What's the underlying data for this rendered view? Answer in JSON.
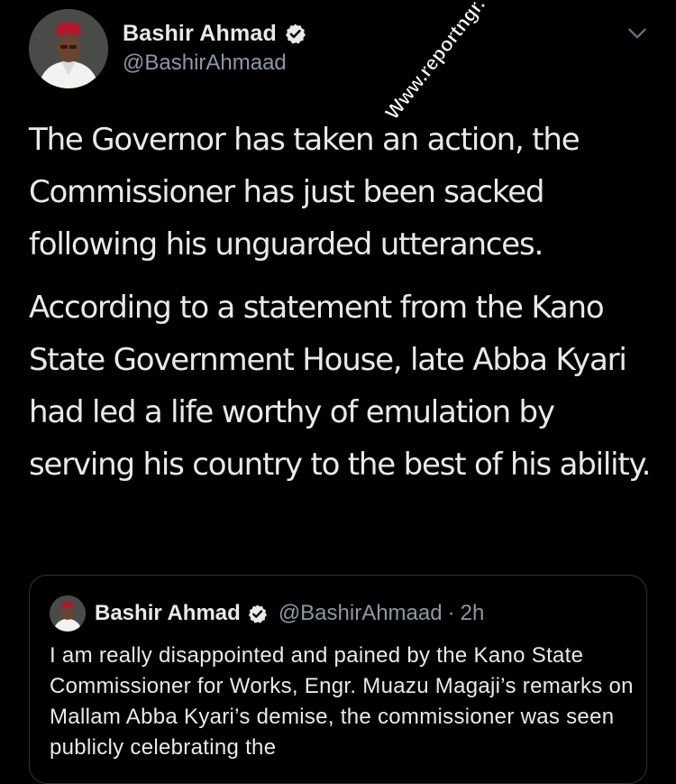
{
  "tweet": {
    "author_name": "Bashir Ahmad",
    "handle": "@BashirAhmaad",
    "paragraphs": [
      "The Governor has taken an action, the Commissioner has just been sacked following his unguarded utterances.",
      "According to a statement from the Kano State Government House, late Abba Kyari had led a life worthy of emulation by serving his country to the best of his ability."
    ]
  },
  "watermark": "Www.reportngr.",
  "quoted_tweet": {
    "author_name": "Bashir Ahmad",
    "handle": "@BashirAhmaad",
    "separator": "·",
    "time": "2h",
    "text": "I am really disappointed and pained by the Kano State Commissioner for Works, Engr. Muazu Magaji’s remarks on Mallam Abba Kyari’s demise, the commissioner was seen publicly celebrating the"
  },
  "icons": {
    "verified": "verified-badge-icon",
    "menu": "chevron-down-icon"
  },
  "colors": {
    "background": "#000000",
    "text": "#e7e9ea",
    "secondary": "#8b98a5",
    "border": "#2f3336"
  }
}
